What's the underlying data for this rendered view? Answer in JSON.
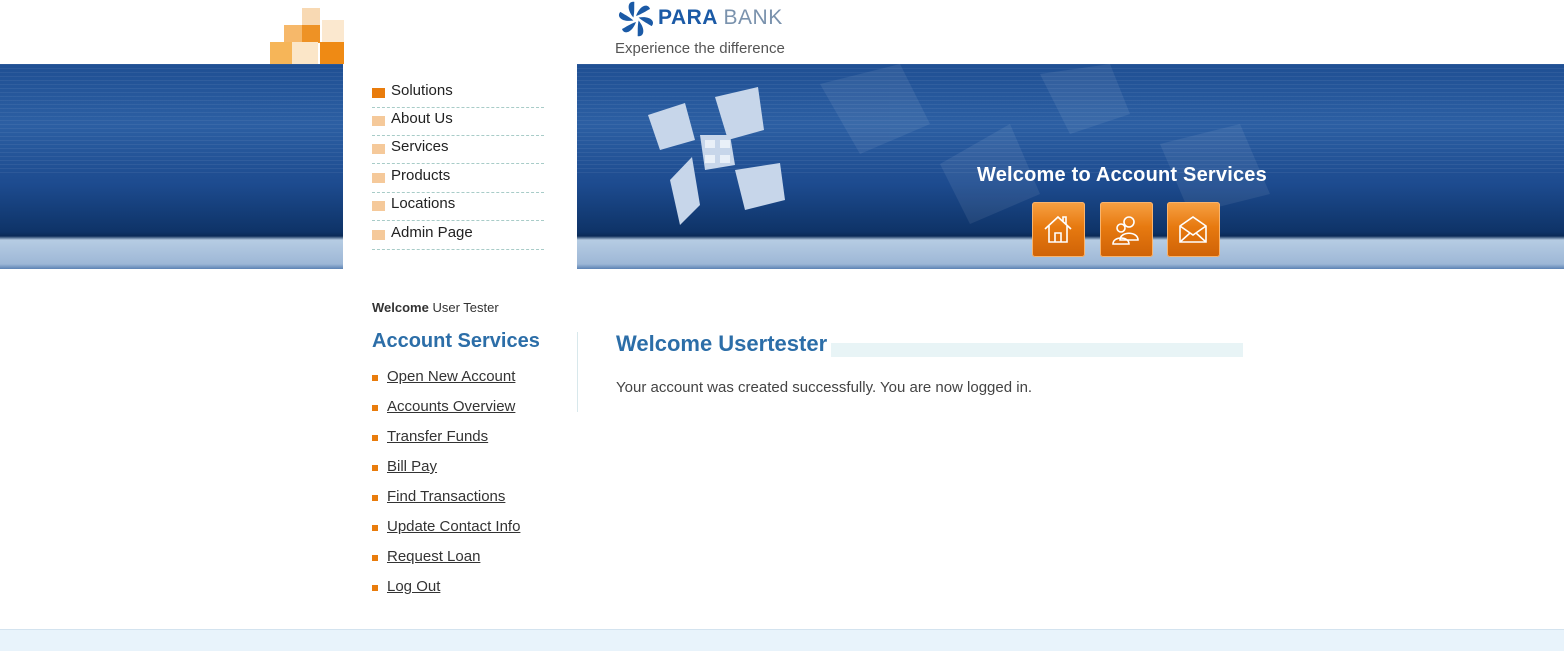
{
  "brand": {
    "name_bold": "PARA",
    "name_light": "BANK",
    "tagline": "Experience the difference"
  },
  "top_menu": [
    {
      "label": "Solutions",
      "active": true
    },
    {
      "label": "About Us",
      "active": false
    },
    {
      "label": "Services",
      "active": false
    },
    {
      "label": "Products",
      "active": false
    },
    {
      "label": "Locations",
      "active": false
    },
    {
      "label": "Admin Page",
      "active": false
    }
  ],
  "banner": {
    "welcome_text": "Welcome to Account Services",
    "icons": [
      "home-icon",
      "contact-people-icon",
      "email-icon"
    ]
  },
  "sidebar": {
    "welcome_label": "Welcome",
    "user_name": "User Tester",
    "title": "Account Services",
    "links": [
      "Open New Account",
      "Accounts Overview",
      "Transfer Funds",
      "Bill Pay",
      "Find Transactions",
      "Update Contact Info",
      "Request Loan",
      "Log Out"
    ]
  },
  "main": {
    "title": "Welcome Usertester",
    "message": "Your account was created successfully. You are now logged in."
  },
  "colors": {
    "accent_orange": "#e97c0c",
    "header_blue": "#1f4f93",
    "title_blue": "#2c6ea8"
  }
}
